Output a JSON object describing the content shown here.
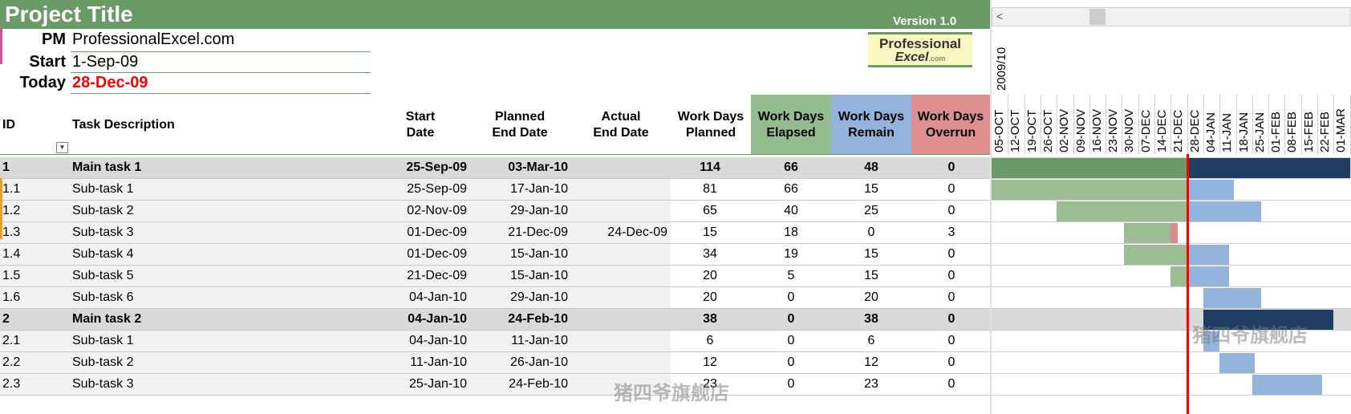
{
  "header": {
    "title": "Project Title",
    "version": "Version 1.0",
    "pm_label": "PM",
    "pm_value": "ProfessionalExcel.com",
    "start_label": "Start",
    "start_value": "1-Sep-09",
    "today_label": "Today",
    "today_value": "28-Dec-09",
    "today_color": "#ff0000",
    "logo_line1": "Professional",
    "logo_line2": "Excel",
    "logo_small": ".com"
  },
  "columns": {
    "id": "ID",
    "desc": "Task Description",
    "start_1": "Start",
    "start_2": "Date",
    "pend_1": "Planned",
    "pend_2": "End Date",
    "aend_1": "Actual",
    "aend_2": "End Date",
    "wp_1": "Work Days",
    "wp_2": "Planned",
    "we_1": "Work Days",
    "we_2": "Elapsed",
    "wr_1": "Work Days",
    "wr_2": "Remain",
    "wo_1": "Work Days",
    "wo_2": "Overrun"
  },
  "colors": {
    "header_green": "#6a9a66",
    "elapsed_header": "#93bd8f",
    "remain_header": "#93b3dc",
    "overrun_header": "#de9090",
    "elapsed_bar": "#9cbc94",
    "remain_bar": "#94b4dc",
    "main_done": "#6a9a66",
    "main_remain": "#203e64",
    "overrun_bar": "#e28a8a",
    "today_line": "#ff0000"
  },
  "rows": [
    {
      "id": "1",
      "desc": "Main task 1",
      "start": "25-Sep-09",
      "pend": "03-Mar-10",
      "aend": "",
      "wp": "114",
      "we": "66",
      "wr": "48",
      "wo": "0",
      "main": true
    },
    {
      "id": "1.1",
      "desc": "Sub-task 1",
      "start": "25-Sep-09",
      "pend": "17-Jan-10",
      "aend": "",
      "wp": "81",
      "we": "66",
      "wr": "15",
      "wo": "0",
      "main": false
    },
    {
      "id": "1.2",
      "desc": "Sub-task 2",
      "start": "02-Nov-09",
      "pend": "29-Jan-10",
      "aend": "",
      "wp": "65",
      "we": "40",
      "wr": "25",
      "wo": "0",
      "main": false
    },
    {
      "id": "1.3",
      "desc": "Sub-task 3",
      "start": "01-Dec-09",
      "pend": "21-Dec-09",
      "aend": "24-Dec-09",
      "wp": "15",
      "we": "18",
      "wr": "0",
      "wo": "3",
      "main": false
    },
    {
      "id": "1.4",
      "desc": "Sub-task 4",
      "start": "01-Dec-09",
      "pend": "15-Jan-10",
      "aend": "",
      "wp": "34",
      "we": "19",
      "wr": "15",
      "wo": "0",
      "main": false
    },
    {
      "id": "1.5",
      "desc": "Sub-task 5",
      "start": "21-Dec-09",
      "pend": "15-Jan-10",
      "aend": "",
      "wp": "20",
      "we": "5",
      "wr": "15",
      "wo": "0",
      "main": false
    },
    {
      "id": "1.6",
      "desc": "Sub-task 6",
      "start": "04-Jan-10",
      "pend": "29-Jan-10",
      "aend": "",
      "wp": "20",
      "we": "0",
      "wr": "20",
      "wo": "0",
      "main": false
    },
    {
      "id": "2",
      "desc": "Main task 2",
      "start": "04-Jan-10",
      "pend": "24-Feb-10",
      "aend": "",
      "wp": "38",
      "we": "0",
      "wr": "38",
      "wo": "0",
      "main": true
    },
    {
      "id": "2.1",
      "desc": "Sub-task 1",
      "start": "04-Jan-10",
      "pend": "11-Jan-10",
      "aend": "",
      "wp": "6",
      "we": "0",
      "wr": "6",
      "wo": "0",
      "main": false
    },
    {
      "id": "2.2",
      "desc": "Sub-task 2",
      "start": "11-Jan-10",
      "pend": "26-Jan-10",
      "aend": "",
      "wp": "12",
      "we": "0",
      "wr": "12",
      "wo": "0",
      "main": false
    },
    {
      "id": "2.3",
      "desc": "Sub-task 3",
      "start": "25-Jan-10",
      "pend": "24-Feb-10",
      "aend": "",
      "wp": "23",
      "we": "0",
      "wr": "23",
      "wo": "0",
      "main": false
    }
  ],
  "gantt": {
    "year_label": "2009/10",
    "weeks": [
      "05-OCT",
      "12-OCT",
      "19-OCT",
      "26-OCT",
      "02-NOV",
      "09-NOV",
      "16-NOV",
      "23-NOV",
      "30-NOV",
      "07-DEC",
      "14-DEC",
      "21-DEC",
      "28-DEC",
      "04-JAN",
      "11-JAN",
      "18-JAN",
      "25-JAN",
      "01-FEB",
      "08-FEB",
      "15-FEB",
      "22-FEB",
      "01-MAR"
    ],
    "axis_start": "2009-10-05",
    "today": "2009-12-28",
    "bars": [
      [
        {
          "from": "2009-10-05",
          "to": "2009-12-28",
          "kind": "main_done"
        },
        {
          "from": "2009-12-28",
          "to": "2010-03-08",
          "kind": "main_remain"
        }
      ],
      [
        {
          "from": "2009-10-05",
          "to": "2009-12-28",
          "kind": "elapsed"
        },
        {
          "from": "2009-12-28",
          "to": "2010-01-17",
          "kind": "remain"
        }
      ],
      [
        {
          "from": "2009-11-02",
          "to": "2009-12-28",
          "kind": "elapsed"
        },
        {
          "from": "2009-12-28",
          "to": "2010-01-29",
          "kind": "remain"
        }
      ],
      [
        {
          "from": "2009-12-01",
          "to": "2009-12-21",
          "kind": "elapsed"
        },
        {
          "from": "2009-12-21",
          "to": "2009-12-24",
          "kind": "overrun"
        }
      ],
      [
        {
          "from": "2009-12-01",
          "to": "2009-12-28",
          "kind": "elapsed"
        },
        {
          "from": "2009-12-28",
          "to": "2010-01-15",
          "kind": "remain"
        }
      ],
      [
        {
          "from": "2009-12-21",
          "to": "2009-12-28",
          "kind": "elapsed"
        },
        {
          "from": "2009-12-28",
          "to": "2010-01-15",
          "kind": "remain"
        }
      ],
      [
        {
          "from": "2010-01-04",
          "to": "2010-01-29",
          "kind": "remain"
        }
      ],
      [
        {
          "from": "2010-01-04",
          "to": "2010-03-01",
          "kind": "main_remain"
        }
      ],
      [
        {
          "from": "2010-01-04",
          "to": "2010-01-11",
          "kind": "remain"
        }
      ],
      [
        {
          "from": "2010-01-11",
          "to": "2010-01-26",
          "kind": "remain"
        }
      ],
      [
        {
          "from": "2010-01-25",
          "to": "2010-02-24",
          "kind": "remain"
        }
      ]
    ]
  },
  "watermark": "猪四爷旗舰店"
}
